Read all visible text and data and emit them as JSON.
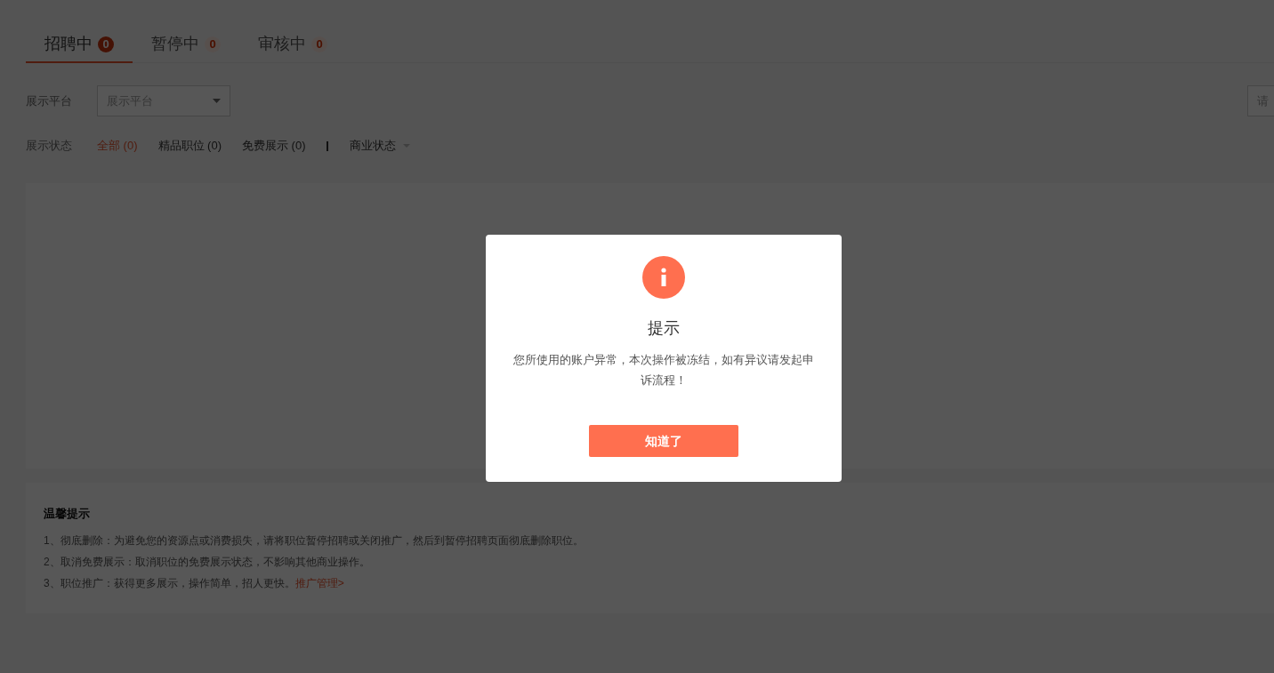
{
  "tabs": [
    {
      "label": "招聘中",
      "count": "0",
      "selected": true
    },
    {
      "label": "暂停中",
      "count": "0",
      "selected": false
    },
    {
      "label": "审核中",
      "count": "0",
      "selected": false
    }
  ],
  "platform_filter": {
    "label": "展示平台",
    "value": "展示平台"
  },
  "search": {
    "placeholder": "请"
  },
  "status_filter": {
    "label": "展示状态",
    "options": [
      {
        "label": "全部 (0)",
        "selected": true
      },
      {
        "label": "精品职位 (0)",
        "selected": false
      },
      {
        "label": "免费展示 (0)",
        "selected": false
      }
    ],
    "business_status": "商业状态"
  },
  "tips": {
    "title": "温馨提示",
    "items": [
      "1、彻底删除：为避免您的资源点或消费损失，请将职位暂停招聘或关闭推广，然后到暂停招聘页面彻底删除职位。",
      "2、取消免费展示：取消职位的免费展示状态，不影响其他商业操作。",
      "3、职位推广：获得更多展示，操作简单，招人更快。"
    ],
    "link": "推广管理>"
  },
  "dialog": {
    "title": "提示",
    "message": "您所使用的账户异常，本次操作被冻结，如有异议请发起申诉流程！",
    "button": "知道了"
  }
}
